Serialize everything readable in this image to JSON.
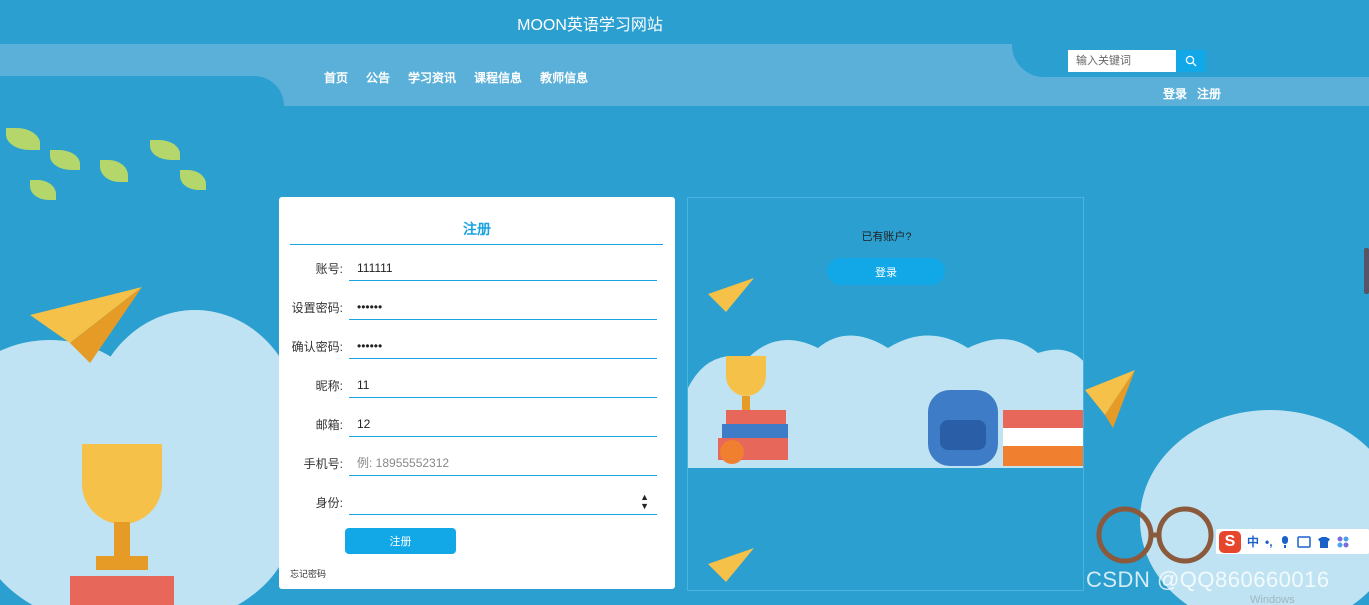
{
  "header": {
    "site_title": "MOON英语学习网站",
    "nav": [
      "首页",
      "公告",
      "学习资讯",
      "课程信息",
      "教师信息"
    ],
    "search_placeholder": "输入关键词",
    "login_link": "登录",
    "register_link": "注册"
  },
  "register_form": {
    "title": "注册",
    "fields": [
      {
        "label": "账号:",
        "value": "111111",
        "placeholder": "",
        "type": "text"
      },
      {
        "label": "设置密码:",
        "value": "111111",
        "placeholder": "",
        "type": "password"
      },
      {
        "label": "确认密码:",
        "value": "111111",
        "placeholder": "",
        "type": "password"
      },
      {
        "label": "昵称:",
        "value": "11",
        "placeholder": "",
        "type": "text"
      },
      {
        "label": "邮箱:",
        "value": "12",
        "placeholder": "",
        "type": "text"
      },
      {
        "label": "手机号:",
        "value": "",
        "placeholder": "例: 18955552312",
        "type": "text"
      },
      {
        "label": "身份:",
        "value": "",
        "placeholder": "",
        "type": "select"
      }
    ],
    "submit_label": "注册",
    "forgot_label": "忘记密码"
  },
  "side_panel": {
    "prompt": "已有账户?",
    "login_button": "登录"
  },
  "overlay": {
    "ime_logo": "S",
    "ime_mode": "中",
    "watermark": "CSDN @QQ860660016",
    "windows_text": "Windows"
  },
  "colors": {
    "accent": "#1aa3e0",
    "button": "#12a8e8",
    "background": "#2a9fd0",
    "nav_bar": "#5ab0d8"
  }
}
